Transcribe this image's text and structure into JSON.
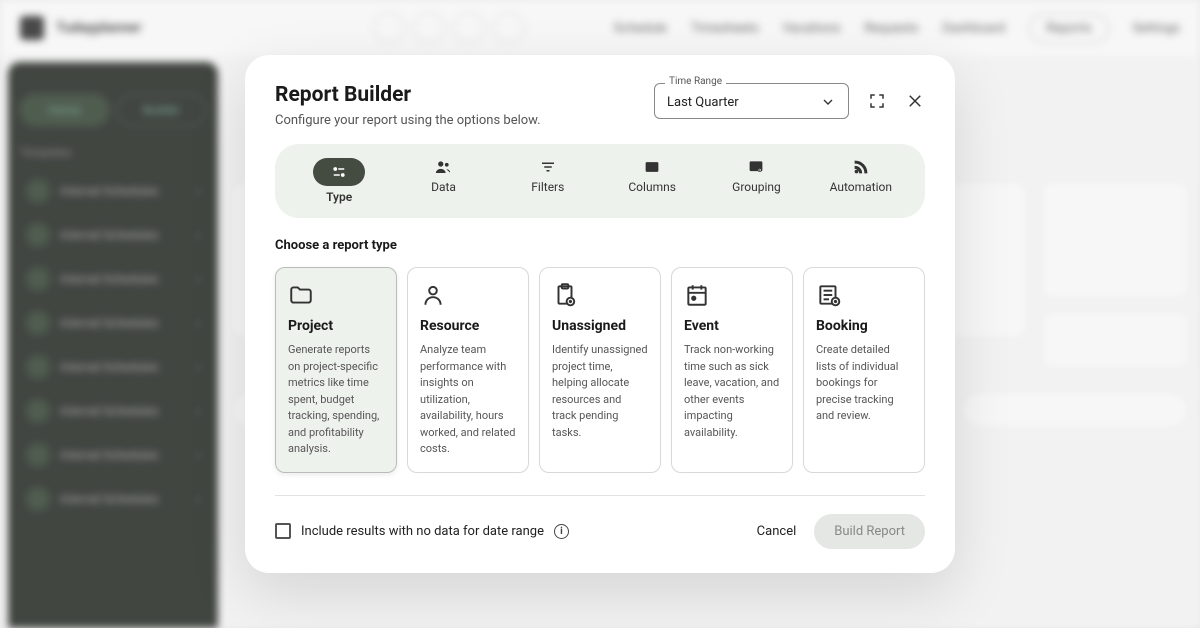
{
  "background": {
    "brand": "Tudayplanner",
    "nav": [
      "Schedule",
      "Timesheets",
      "Vacations",
      "Requests",
      "Dashboard",
      "Reports",
      "Settings"
    ],
    "sidebar": {
      "tabs": [
        "Home",
        "Builder"
      ],
      "section_label": "Templates",
      "item_label": "Internal Schedules"
    }
  },
  "modal": {
    "title": "Report Builder",
    "subtitle": "Configure your report using the options below.",
    "time_range": {
      "legend": "Time Range",
      "value": "Last Quarter"
    },
    "tabs": [
      {
        "label": "Type",
        "icon": "sliders"
      },
      {
        "label": "Data",
        "icon": "users"
      },
      {
        "label": "Filters",
        "icon": "filter"
      },
      {
        "label": "Columns",
        "icon": "columns"
      },
      {
        "label": "Grouping",
        "icon": "group"
      },
      {
        "label": "Automation",
        "icon": "rss"
      }
    ],
    "section_title": "Choose a report type",
    "cards": [
      {
        "title": "Project",
        "desc": "Generate reports on project-specific metrics like time spent, budget tracking, spending, and profitability analysis.",
        "icon": "folder"
      },
      {
        "title": "Resource",
        "desc": "Analyze team performance with insights on utilization, availability, hours worked, and related costs.",
        "icon": "person"
      },
      {
        "title": "Unassigned",
        "desc": "Identify unassigned project time, helping allocate resources and track pending tasks.",
        "icon": "clipboard-plus"
      },
      {
        "title": "Event",
        "desc": "Track non-working time such as sick leave, vacation, and other events impacting availability.",
        "icon": "calendar"
      },
      {
        "title": "Booking",
        "desc": "Create detailed lists of individual bookings for precise tracking and review.",
        "icon": "list-plus"
      }
    ],
    "checkbox_label": "Include results with no data for date range",
    "cancel_label": "Cancel",
    "build_label": "Build Report"
  }
}
